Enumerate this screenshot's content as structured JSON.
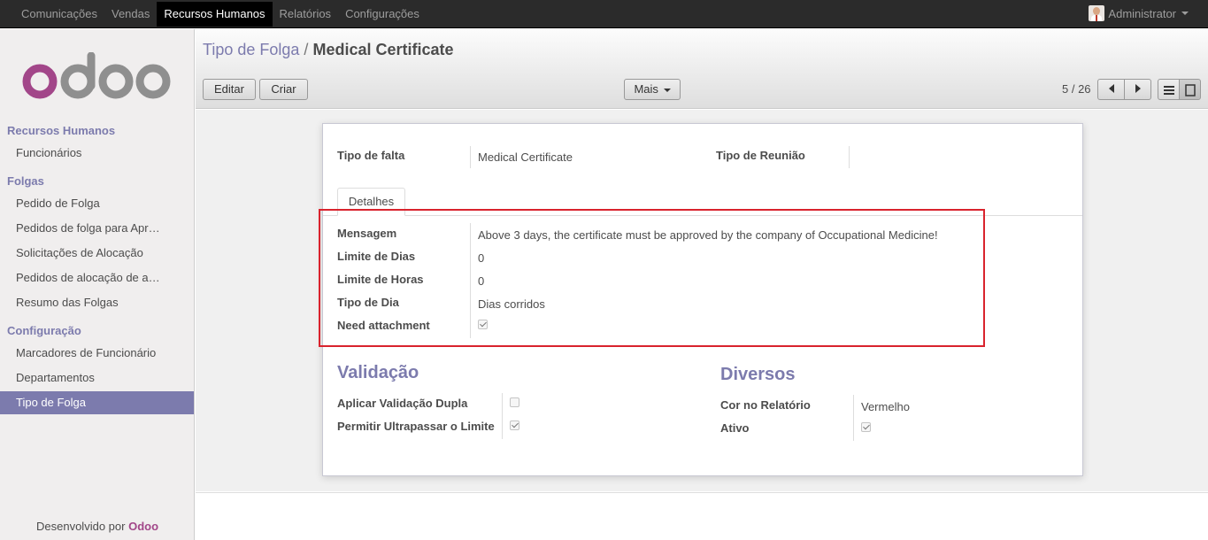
{
  "topbar": {
    "menu": [
      "Comunicações",
      "Vendas",
      "Recursos Humanos",
      "Relatórios",
      "Configurações"
    ],
    "user": "Administrator"
  },
  "sidebar": {
    "logo_text": "odoo",
    "sections": {
      "hr": "Recursos Humanos",
      "folgas": "Folgas",
      "config": "Configuração"
    },
    "items": {
      "funcionarios": "Funcionários",
      "pedido_folga": "Pedido de Folga",
      "pedidos_aprovar": "Pedidos de folga para Aprovar",
      "solicitacoes_alocacao": "Solicitações de Alocação",
      "pedidos_alocacao": "Pedidos de alocação de aprovar",
      "resumo": "Resumo das Folgas",
      "marcadores": "Marcadores de Funcionário",
      "departamentos": "Departamentos",
      "tipo_folga": "Tipo de Folga"
    },
    "footer_prefix": "Desenvolvido por",
    "footer_brand": "Odoo"
  },
  "control_panel": {
    "breadcrumb_parent": "Tipo de Folga",
    "breadcrumb_sep": "/",
    "breadcrumb_current": "Medical Certificate",
    "edit_label": "Editar",
    "create_label": "Criar",
    "more_label": "Mais",
    "pager": "5 / 26"
  },
  "form": {
    "tipo_falta_label": "Tipo de falta",
    "tipo_falta_value": "Medical Certificate",
    "tipo_reuniao_label": "Tipo de Reunião",
    "tipo_reuniao_value": "",
    "tab_label": "Detalhes",
    "mensagem_label": "Mensagem",
    "mensagem_value": "Above 3 days, the certificate must be approved by the company of Occupational Medicine!",
    "limite_dias_label": "Limite de Dias",
    "limite_dias_value": "0",
    "limite_horas_label": "Limite de Horas",
    "limite_horas_value": "0",
    "tipo_dia_label": "Tipo de Dia",
    "tipo_dia_value": "Dias corridos",
    "need_attachment_label": "Need attachment",
    "need_attachment_checked": true,
    "validacao_title": "Validação",
    "dupla_label": "Aplicar Validação Dupla",
    "dupla_checked": false,
    "ultrapassar_label": "Permitir Ultrapassar o Limite",
    "ultrapassar_checked": true,
    "diversos_title": "Diversos",
    "cor_label": "Cor no Relatório",
    "cor_value": "Vermelho",
    "ativo_label": "Ativo",
    "ativo_checked": true
  },
  "colors": {
    "accent": "#7c7bad",
    "brand": "#a24689",
    "highlight_box": "#d9232d"
  }
}
